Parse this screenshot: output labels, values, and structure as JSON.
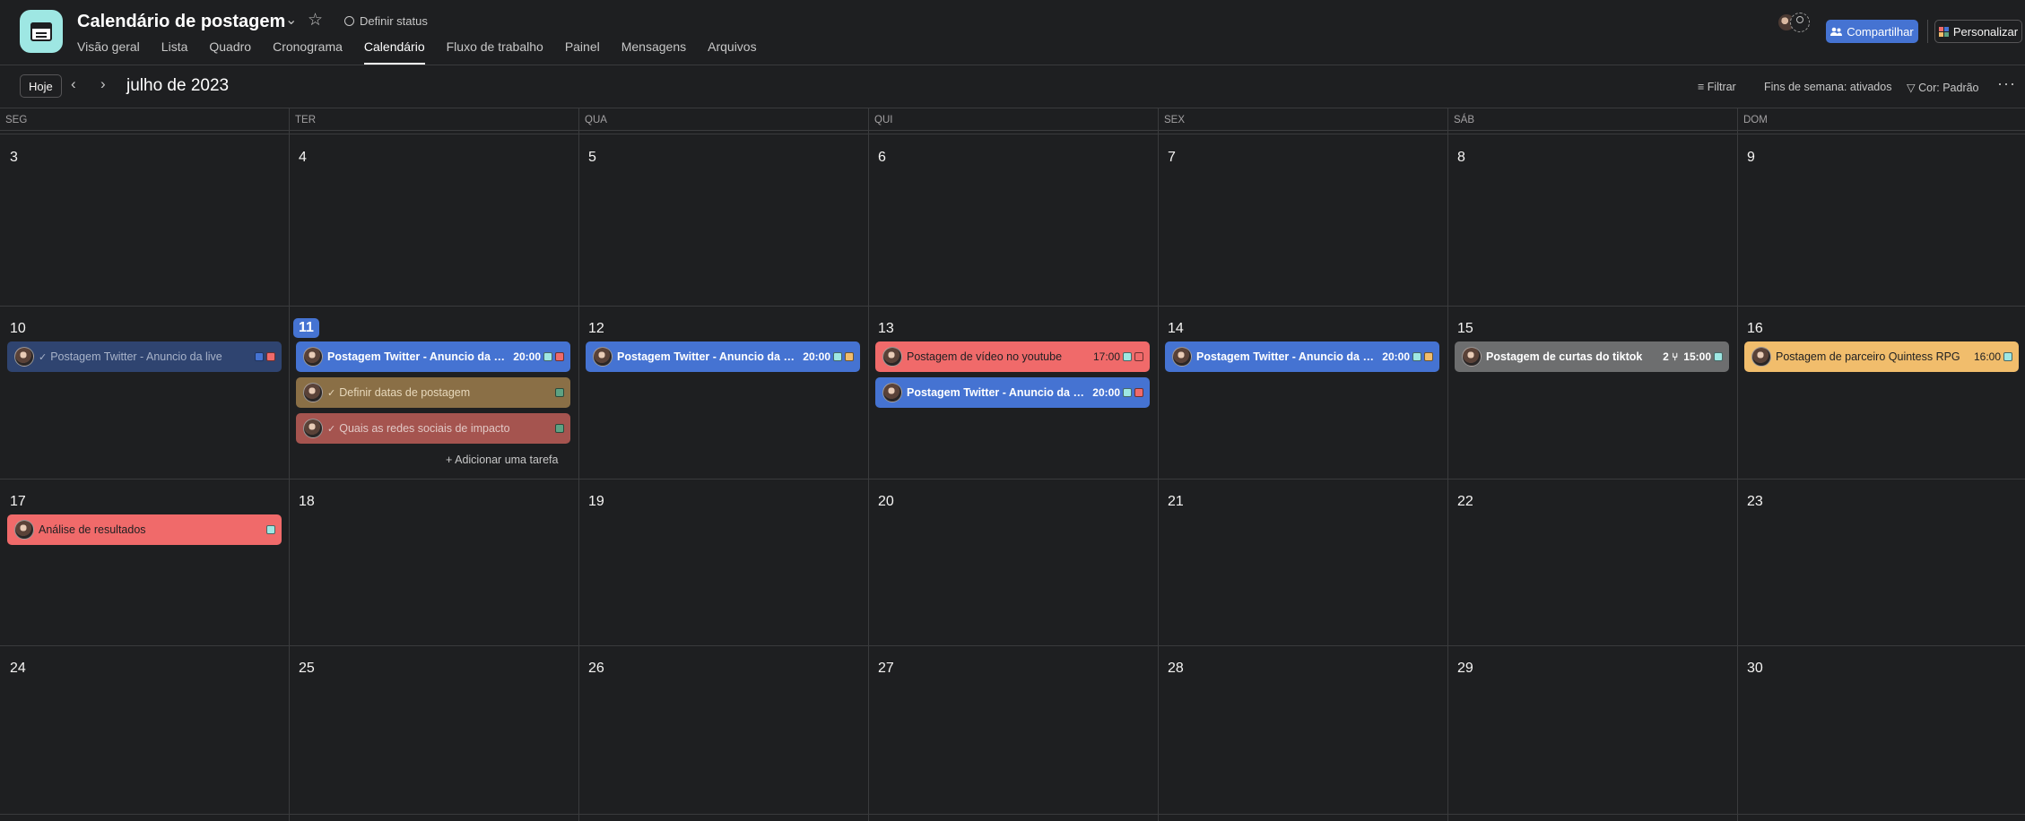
{
  "project": {
    "title": "Calendário de postagem",
    "status_label": "Definir status"
  },
  "tabs": [
    {
      "label": "Visão geral"
    },
    {
      "label": "Lista"
    },
    {
      "label": "Quadro"
    },
    {
      "label": "Cronograma"
    },
    {
      "label": "Calendário",
      "active": true
    },
    {
      "label": "Fluxo de trabalho"
    },
    {
      "label": "Painel"
    },
    {
      "label": "Mensagens"
    },
    {
      "label": "Arquivos"
    }
  ],
  "header_actions": {
    "share_label": "Compartilhar",
    "customize_label": "Personalizar"
  },
  "toolbar": {
    "today_label": "Hoje",
    "month_label": "julho de 2023",
    "filter_label": "Filtrar",
    "weekends_label": "Fins de semana: ativados",
    "color_label": "Cor: Padrão"
  },
  "weekdays": [
    "SEG",
    "TER",
    "QUA",
    "QUI",
    "SEX",
    "SÁB",
    "DOM"
  ],
  "weeks": [
    [
      "3",
      "4",
      "5",
      "6",
      "7",
      "8",
      "9"
    ],
    [
      "10",
      "11",
      "12",
      "13",
      "14",
      "15",
      "16"
    ],
    [
      "17",
      "18",
      "19",
      "20",
      "21",
      "22",
      "23"
    ],
    [
      "24",
      "25",
      "26",
      "27",
      "28",
      "29",
      "30"
    ]
  ],
  "today": "11",
  "add_task_label": "Adicionar uma tarefa",
  "tasks": [
    {
      "name": "Postagem Twitter - Anuncio da live",
      "day": "10",
      "slot": 0,
      "color": "blue",
      "completed": true,
      "time": "",
      "tags": [
        "#4573d2",
        "#f06a6a"
      ]
    },
    {
      "name": "Postagem Twitter - Anuncio da live",
      "day": "11",
      "slot": 0,
      "color": "blue",
      "completed": false,
      "time": "20:00",
      "tags": [
        "#9ee7e3",
        "#f06a6a"
      ]
    },
    {
      "name": "Definir datas de postagem",
      "day": "11",
      "slot": 1,
      "color": "yellow",
      "completed": true,
      "time": "",
      "tags": [
        "#5da283"
      ]
    },
    {
      "name": "Quais as redes sociais de impacto",
      "day": "11",
      "slot": 2,
      "color": "red",
      "completed": true,
      "time": "",
      "tags": [
        "#5da283"
      ]
    },
    {
      "name": "Postagem Twitter - Anuncio da live",
      "day": "12",
      "slot": 0,
      "color": "blue",
      "completed": false,
      "time": "20:00",
      "tags": [
        "#9ee7e3",
        "#f1bd6c"
      ]
    },
    {
      "name": "Postagem de vídeo no youtube",
      "day": "13",
      "slot": 0,
      "color": "red",
      "completed": false,
      "time": "17:00",
      "tags": [
        "#9ee7e3",
        "#f06a6a"
      ]
    },
    {
      "name": "Postagem Twitter - Anuncio da live",
      "day": "13",
      "slot": 1,
      "color": "blue",
      "completed": false,
      "time": "20:00",
      "tags": [
        "#9ee7e3",
        "#f06a6a"
      ]
    },
    {
      "name": "Postagem Twitter - Anuncio da live",
      "day": "14",
      "slot": 0,
      "color": "blue",
      "completed": false,
      "time": "20:00",
      "tags": [
        "#9ee7e3",
        "#f1bd6c"
      ]
    },
    {
      "name": "Postagem de curtas do tiktok",
      "day": "15",
      "slot": 0,
      "color": "gray",
      "completed": false,
      "time": "15:00",
      "subtasks": "2",
      "tags": [
        "#9ee7e3"
      ]
    },
    {
      "name": "Postagem de parceiro Quintess RPG",
      "day": "16",
      "slot": 0,
      "color": "yellow",
      "completed": false,
      "time": "16:00",
      "tags": [
        "#9ee7e3"
      ]
    },
    {
      "name": "Análise de resultados",
      "day": "17",
      "slot": 0,
      "color": "red",
      "completed": false,
      "time": "",
      "tags": [
        "#9ee7e3"
      ]
    }
  ]
}
